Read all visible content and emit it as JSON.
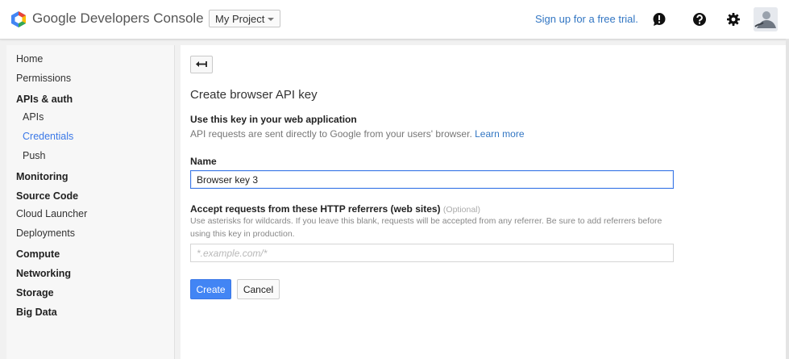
{
  "header": {
    "brand": "Google Developers Console",
    "project_selector": "My Project",
    "trial_link": "Sign up for a free trial.",
    "icons": [
      "feedback-icon",
      "help-icon",
      "settings-icon"
    ],
    "accent_color": "#3b78e7"
  },
  "sidebar": {
    "items": [
      {
        "label": "Home"
      },
      {
        "label": "Permissions"
      },
      {
        "label": "APIs & auth"
      },
      {
        "label": "APIs"
      },
      {
        "label": "Credentials"
      },
      {
        "label": "Push"
      },
      {
        "label": "Monitoring"
      },
      {
        "label": "Source Code"
      },
      {
        "label": "Cloud Launcher"
      },
      {
        "label": "Deployments"
      },
      {
        "label": "Compute"
      },
      {
        "label": "Networking"
      },
      {
        "label": "Storage"
      },
      {
        "label": "Big Data"
      }
    ]
  },
  "main": {
    "title": "Create browser API key",
    "section_heading": "Use this key in your web application",
    "section_desc": "API requests are sent directly to Google from your users' browser.",
    "learn_more": "Learn more",
    "name_label": "Name",
    "name_value": "Browser key 3",
    "referrers_label": "Accept requests from these HTTP referrers (web sites)",
    "referrers_optional": "(Optional)",
    "referrers_help": "Use asterisks for wildcards. If you leave this blank, requests will be accepted from any referrer. Be sure to add referrers before using this key in production.",
    "referrers_placeholder": "*.example.com/*",
    "create_label": "Create",
    "cancel_label": "Cancel"
  }
}
